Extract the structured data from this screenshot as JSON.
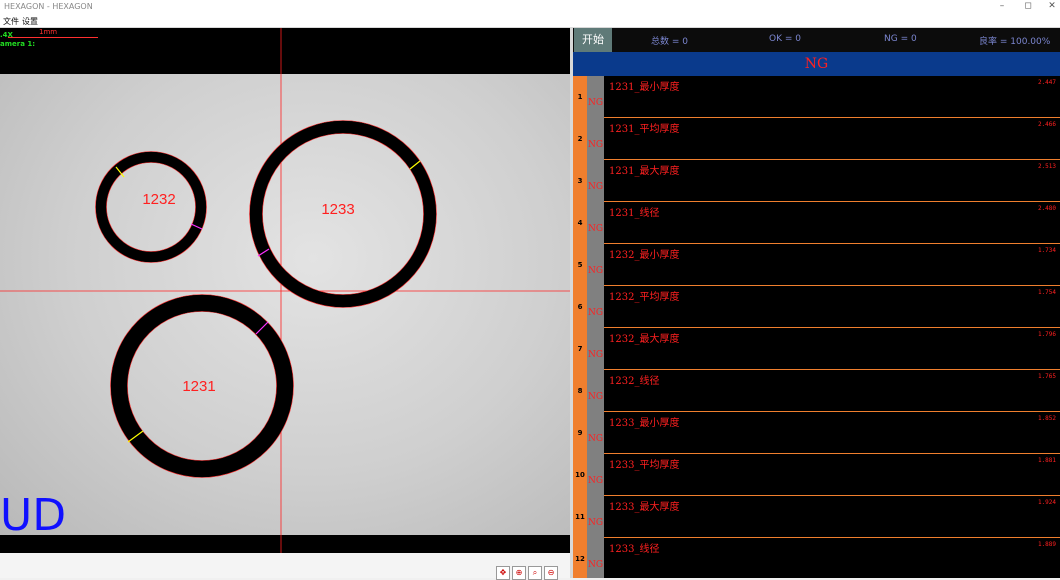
{
  "window": {
    "title": "HEXAGON - HEXAGON",
    "minimize": "–",
    "maximize": "◻",
    "close": "✕"
  },
  "menu": [
    {
      "label": "文件"
    },
    {
      "label": "设置"
    }
  ],
  "camera": {
    "zoom": ".4X",
    "scale_label": "1mm",
    "name": "amera 1:",
    "overlay_text": "UD",
    "rings": [
      {
        "label": "1232"
      },
      {
        "label": "1233"
      },
      {
        "label": "1231"
      }
    ]
  },
  "panel": {
    "start_label": "开始",
    "total": "总数 = 0",
    "ok": "OK = 0",
    "ng": "NG = 0",
    "yield": "良率 = 100.00%",
    "status": "NG",
    "rows": [
      {
        "index": "1",
        "tag": "NG",
        "name": "1231_最小厚度",
        "value": "2.447"
      },
      {
        "index": "2",
        "tag": "NG",
        "name": "1231_平均厚度",
        "value": "2.466"
      },
      {
        "index": "3",
        "tag": "NG",
        "name": "1231_最大厚度",
        "value": "2.513"
      },
      {
        "index": "4",
        "tag": "NG",
        "name": "1231_线径",
        "value": "2.480"
      },
      {
        "index": "5",
        "tag": "NG",
        "name": "1232_最小厚度",
        "value": "1.734"
      },
      {
        "index": "6",
        "tag": "NG",
        "name": "1232_平均厚度",
        "value": "1.754"
      },
      {
        "index": "7",
        "tag": "NG",
        "name": "1232_最大厚度",
        "value": "1.796"
      },
      {
        "index": "8",
        "tag": "NG",
        "name": "1232_线径",
        "value": "1.765"
      },
      {
        "index": "9",
        "tag": "NG",
        "name": "1233_最小厚度",
        "value": "1.852"
      },
      {
        "index": "10",
        "tag": "NG",
        "name": "1233_平均厚度",
        "value": "1.881"
      },
      {
        "index": "11",
        "tag": "NG",
        "name": "1233_最大厚度",
        "value": "1.924"
      },
      {
        "index": "12",
        "tag": "NG",
        "name": "1233_线径",
        "value": "1.889"
      }
    ]
  },
  "toolbar_icons": [
    {
      "name": "target-icon",
      "glyph": "✥"
    },
    {
      "name": "zoom-in-icon",
      "glyph": "⊕"
    },
    {
      "name": "zoom-fit-icon",
      "glyph": "⌕"
    },
    {
      "name": "zoom-out-icon",
      "glyph": "⊖"
    }
  ],
  "colors": {
    "ng_red": "#ff2020",
    "row_accent": "#f07f2e",
    "status_bar": "#0a3a8c",
    "start_button": "#5f7a78"
  }
}
